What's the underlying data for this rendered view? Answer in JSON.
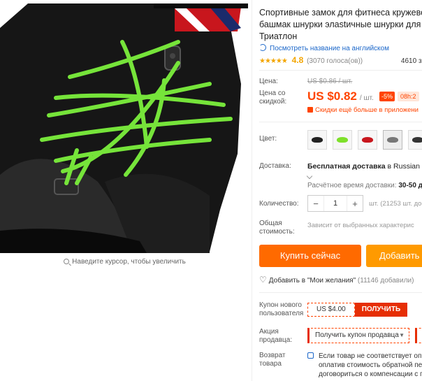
{
  "gallery": {
    "zoom_hint": "Наведите курсор, чтобы увеличить"
  },
  "product": {
    "title": "Спортивные замок для фитнеса кружево башмак шнурки элastичные шнурки для Триатлон",
    "translate_link": "Посмотреть название на английском",
    "stars": "★★★★★",
    "rating": "4.8",
    "votes": "(3070 голоса(ов))",
    "orders": "4610 заказа"
  },
  "price": {
    "label_price": "Цена:",
    "old": "US $0.86 / шт.",
    "label_discount": "Цена со скидкой:",
    "new": "US $0.82",
    "unit": "/ шт.",
    "discount_badge": "-5%",
    "timer": "08h:2",
    "app_deal": "Скидки ещё больше в приложени"
  },
  "color": {
    "label": "Цвет:",
    "swatches": [
      {
        "name": "black",
        "color": "#222222"
      },
      {
        "name": "green",
        "color": "#7ee02a"
      },
      {
        "name": "red",
        "color": "#c8161d"
      },
      {
        "name": "gray",
        "color": "#777777"
      },
      {
        "name": "dark",
        "color": "#333333"
      }
    ]
  },
  "shipping": {
    "label": "Доставка:",
    "free": "Бесплатная доставка",
    "to": "в Russian Fe",
    "estimate_label": "Расчётное время доставки:",
    "estimate_value": "30-50 д"
  },
  "quantity": {
    "label": "Количество:",
    "minus": "−",
    "value": "1",
    "plus": "+",
    "stock": "шт. (21253 шт. досту"
  },
  "total": {
    "label": "Общая стоимость:",
    "note": "Зависит от выбранных характерис"
  },
  "actions": {
    "buy": "Купить сейчас",
    "cart": "Добавить",
    "wish": "Добавить в \"Мои желания\"",
    "wish_count": "(11146 добавили)"
  },
  "coupon": {
    "label": "Купон нового пользователя",
    "amount": "US $4.00",
    "get": "ПОЛУЧИТЬ"
  },
  "seller": {
    "label": "Акция продавца:",
    "button": "Получить купон продавца"
  },
  "returns": {
    "label": "Возврат товара",
    "text": "Если товар не соответствует опи оплатив стоимость обратной пер договориться о компенсации с п"
  },
  "colors": {
    "accent": "#ff4400",
    "buy_button": "#ff6a00",
    "cart_button": "#ff9a00",
    "link": "#1a66c9"
  }
}
